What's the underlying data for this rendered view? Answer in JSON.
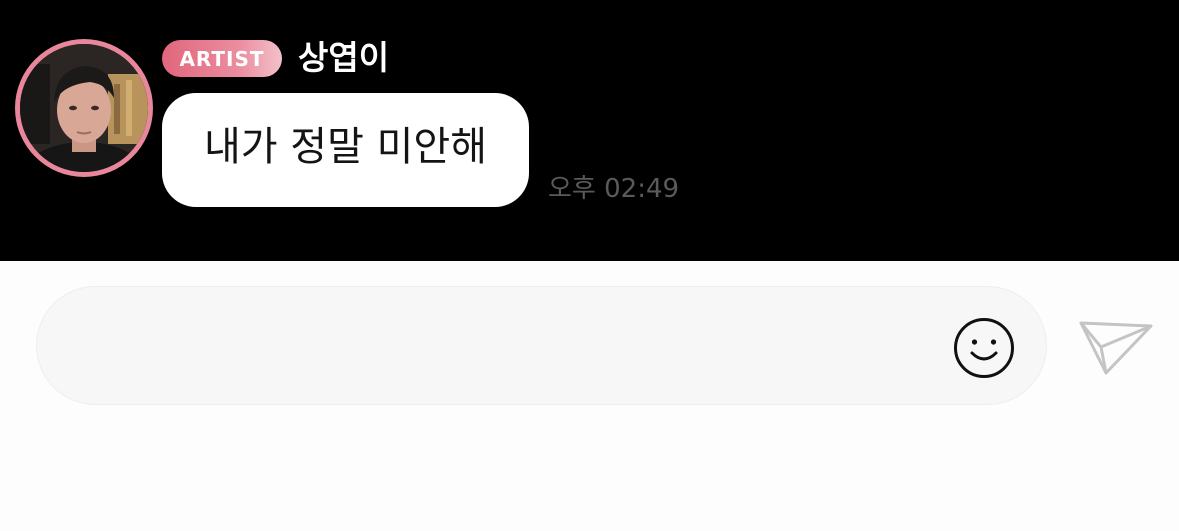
{
  "message": {
    "badge": "ARTIST",
    "sender": "상엽이",
    "text": "내가 정말 미안해",
    "time": "오후 02:49"
  },
  "input": {
    "value": "",
    "placeholder": ""
  },
  "icons": {
    "emoji": "smiley-face-icon",
    "send": "paper-plane-send-icon"
  },
  "colors": {
    "chat_background": "#000000",
    "badge_gradient_start": "#e1667c",
    "badge_gradient_end": "#f3c1ca",
    "avatar_ring": "#e8869b",
    "bubble": "#ffffff",
    "input_background": "#f7f7f7"
  }
}
